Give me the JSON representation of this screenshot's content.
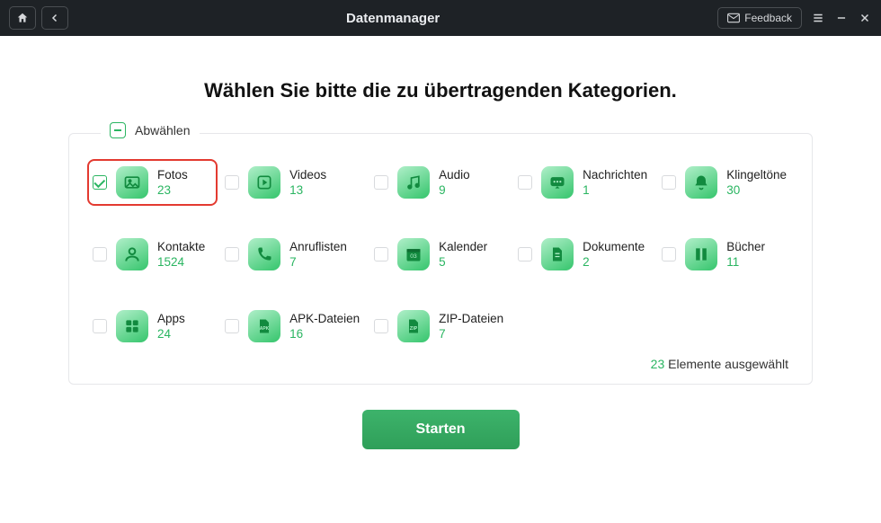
{
  "titlebar": {
    "title": "Datenmanager",
    "feedback": "Feedback"
  },
  "heading": "Wählen Sie bitte die zu übertragenden Kategorien.",
  "deselect_label": "Abwählen",
  "categories": [
    {
      "key": "fotos",
      "label": "Fotos",
      "count": "23",
      "checked": true,
      "highlighted": true,
      "icon": "image-icon"
    },
    {
      "key": "videos",
      "label": "Videos",
      "count": "13",
      "checked": false,
      "highlighted": false,
      "icon": "play-icon"
    },
    {
      "key": "audio",
      "label": "Audio",
      "count": "9",
      "checked": false,
      "highlighted": false,
      "icon": "music-icon"
    },
    {
      "key": "nachrichten",
      "label": "Nachrichten",
      "count": "1",
      "checked": false,
      "highlighted": false,
      "icon": "message-icon"
    },
    {
      "key": "klingeltoene",
      "label": "Klingeltöne",
      "count": "30",
      "checked": false,
      "highlighted": false,
      "icon": "bell-icon"
    },
    {
      "key": "kontakte",
      "label": "Kontakte",
      "count": "1524",
      "checked": false,
      "highlighted": false,
      "icon": "contact-icon"
    },
    {
      "key": "anruflisten",
      "label": "Anruflisten",
      "count": "7",
      "checked": false,
      "highlighted": false,
      "icon": "phone-icon"
    },
    {
      "key": "kalender",
      "label": "Kalender",
      "count": "5",
      "checked": false,
      "highlighted": false,
      "icon": "calendar-icon"
    },
    {
      "key": "dokumente",
      "label": "Dokumente",
      "count": "2",
      "checked": false,
      "highlighted": false,
      "icon": "document-icon"
    },
    {
      "key": "buecher",
      "label": "Bücher",
      "count": "11",
      "checked": false,
      "highlighted": false,
      "icon": "book-icon"
    },
    {
      "key": "apps",
      "label": "Apps",
      "count": "24",
      "checked": false,
      "highlighted": false,
      "icon": "apps-icon"
    },
    {
      "key": "apk",
      "label": "APK-Dateien",
      "count": "16",
      "checked": false,
      "highlighted": false,
      "icon": "apk-icon"
    },
    {
      "key": "zip",
      "label": "ZIP-Dateien",
      "count": "7",
      "checked": false,
      "highlighted": false,
      "icon": "zip-icon"
    }
  ],
  "summary": {
    "count": "23",
    "suffix": "Elemente ausgewählt"
  },
  "start_label": "Starten",
  "colors": {
    "accent": "#2ab561",
    "highlight": "#e33a30"
  }
}
